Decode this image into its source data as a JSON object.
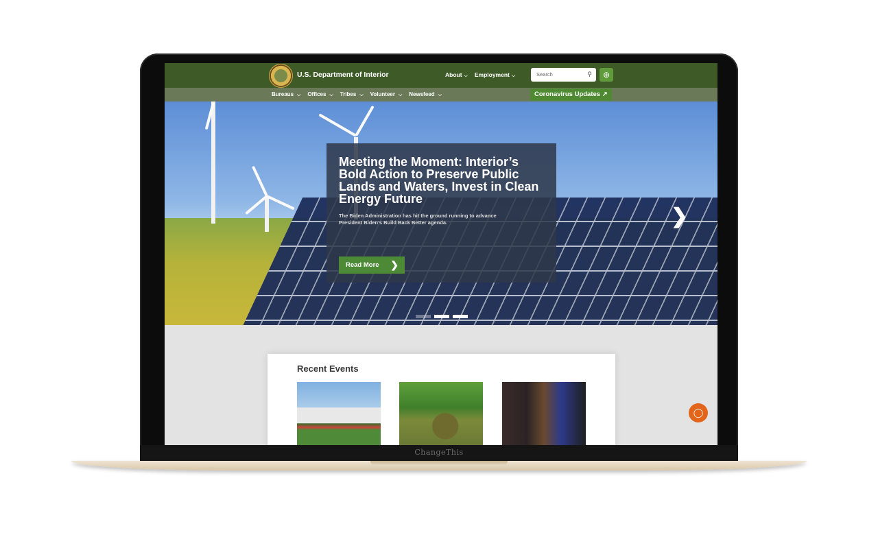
{
  "device": {
    "brand": "ChangeThis"
  },
  "header": {
    "site_title": "U.S. Department of Interior",
    "top_nav": [
      "About",
      "Employment"
    ],
    "search_placeholder": "Search",
    "sub_nav": [
      "Bureaus",
      "Offices",
      "Tribes",
      "Volunteer",
      "Newsfeed"
    ],
    "covid_link": "Coronavirus Updates"
  },
  "hero": {
    "title": "Meeting the Moment: Interior’s Bold Action to Preserve Public Lands and Waters, Invest in Clean Energy Future",
    "subtitle": "The Biden Administration has hit the ground running to advance President Biden’s Build Back Better agenda.",
    "cta": "Read More",
    "slides": 3,
    "active_slide": 1
  },
  "events": {
    "title": "Recent Events"
  },
  "icons": {
    "chevron": "chevron-down-icon",
    "search": "search-icon",
    "globe": "globe-icon",
    "external": "external-link-icon",
    "next": "chevron-right-icon",
    "chat": "chat-icon"
  },
  "colors": {
    "header_green": "#3d5a27",
    "subnav_green": "#6a7a58",
    "accent_green": "#4f8a33",
    "chat_orange": "#e2651a"
  }
}
